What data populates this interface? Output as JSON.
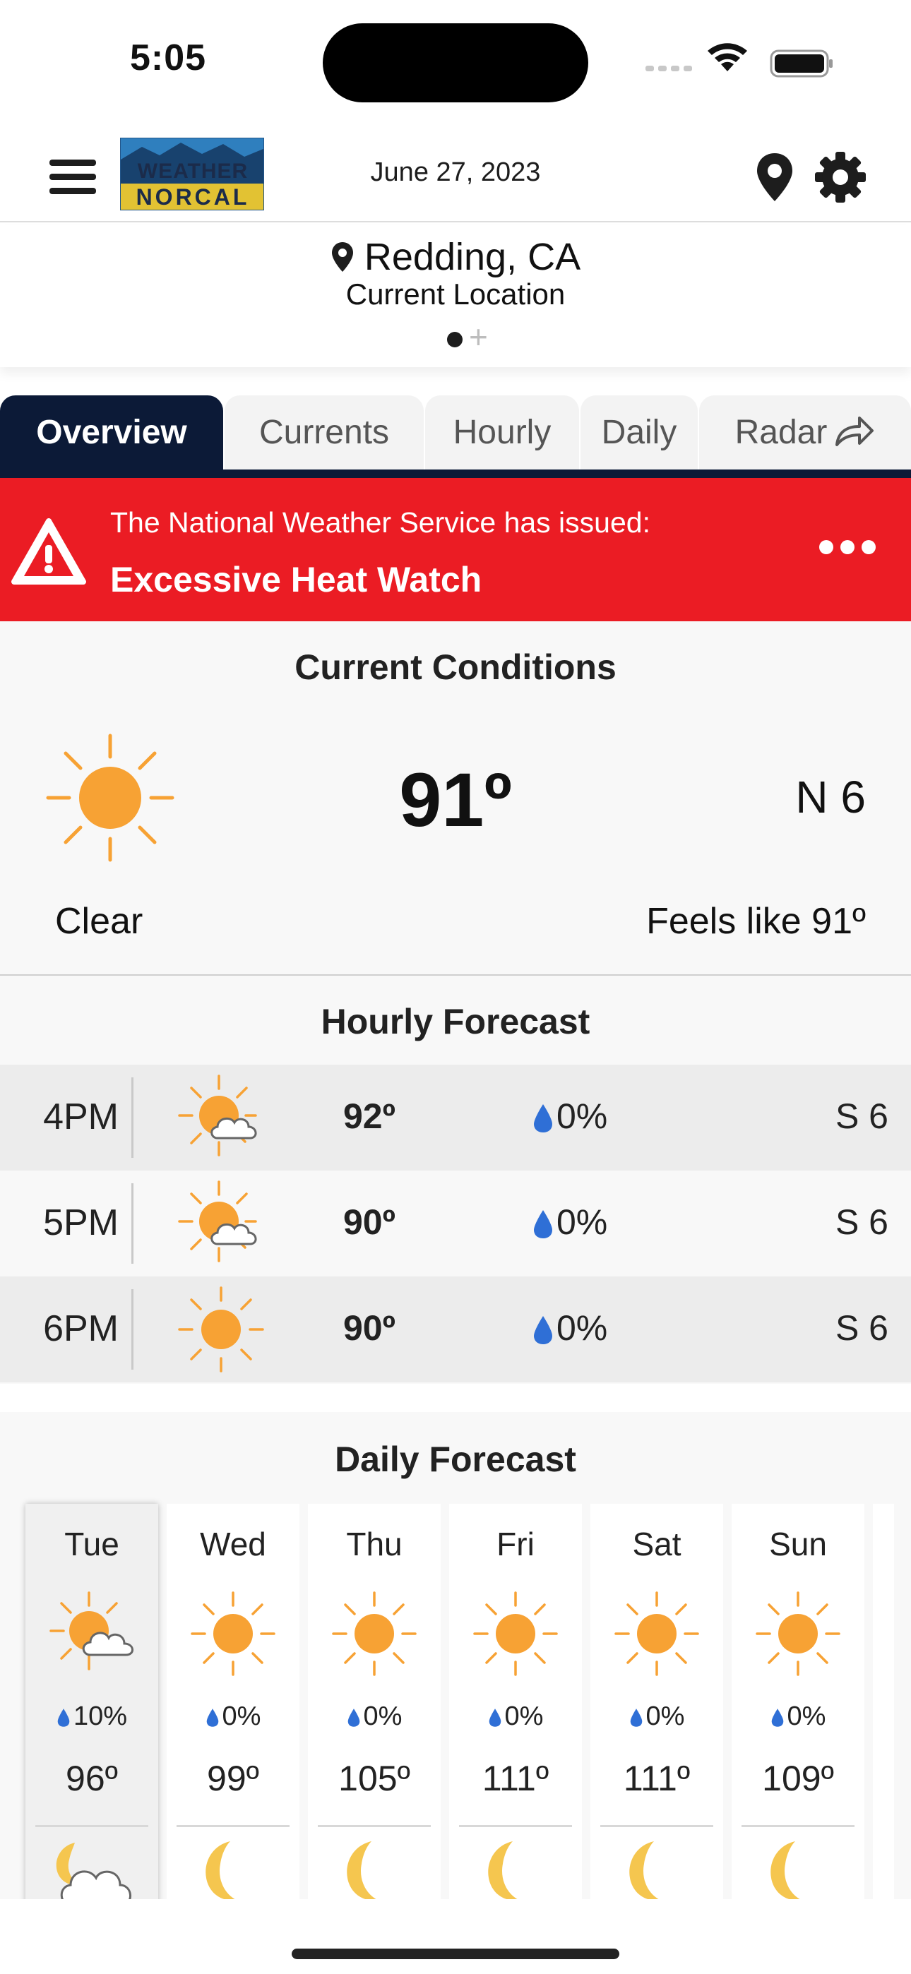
{
  "status_bar": {
    "time": "5:05"
  },
  "header": {
    "logo_top": "WEATHER",
    "logo_bottom": "NORCAL",
    "date": "June 27, 2023"
  },
  "location": {
    "name": "Redding, CA",
    "subtitle": "Current Location"
  },
  "tabs": [
    {
      "label": "Overview",
      "active": true
    },
    {
      "label": "Currents",
      "active": false
    },
    {
      "label": "Hourly",
      "active": false
    },
    {
      "label": "Daily",
      "active": false
    },
    {
      "label": "Radar",
      "active": false
    }
  ],
  "alert": {
    "issuer": "The National Weather Service has issued:",
    "title": "Excessive Heat Watch",
    "color": "#eb1c24"
  },
  "current": {
    "title": "Current Conditions",
    "icon": "sun-icon",
    "temp": "91º",
    "wind": "N 6",
    "condition": "Clear",
    "feels_like": "Feels like 91º"
  },
  "hourly": {
    "title": "Hourly Forecast",
    "rows": [
      {
        "time": "4PM",
        "icon": "partly-cloudy-icon",
        "temp": "92º",
        "precip": "0%",
        "wind": "S 6"
      },
      {
        "time": "5PM",
        "icon": "partly-cloudy-icon",
        "temp": "90º",
        "precip": "0%",
        "wind": "S 6"
      },
      {
        "time": "6PM",
        "icon": "sun-icon",
        "temp": "90º",
        "precip": "0%",
        "wind": "S 6"
      }
    ]
  },
  "daily": {
    "title": "Daily Forecast",
    "days": [
      {
        "day": "Tue",
        "icon": "partly-cloudy-icon",
        "precip": "10%",
        "high": "96º",
        "night_icon": "moon-cloud-icon"
      },
      {
        "day": "Wed",
        "icon": "sun-icon",
        "precip": "0%",
        "high": "99º",
        "night_icon": "moon-icon"
      },
      {
        "day": "Thu",
        "icon": "sun-icon",
        "precip": "0%",
        "high": "105º",
        "night_icon": "moon-icon"
      },
      {
        "day": "Fri",
        "icon": "sun-icon",
        "precip": "0%",
        "high": "111º",
        "night_icon": "moon-icon"
      },
      {
        "day": "Sat",
        "icon": "sun-icon",
        "precip": "0%",
        "high": "111º",
        "night_icon": "moon-icon"
      },
      {
        "day": "Sun",
        "icon": "sun-icon",
        "precip": "0%",
        "high": "109º",
        "night_icon": "moon-icon"
      }
    ]
  },
  "colors": {
    "navy": "#0c1a37",
    "alert_red": "#eb1c24",
    "sun_orange": "#f7a234",
    "rain_blue": "#2f6fd6"
  }
}
